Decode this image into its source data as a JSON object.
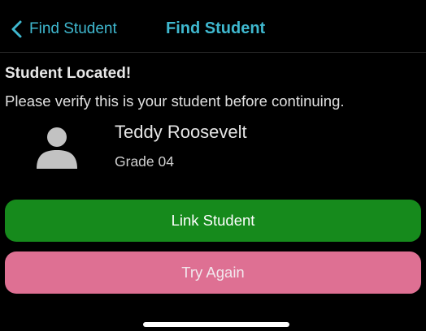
{
  "nav": {
    "back_label": "Find Student",
    "title": "Find Student",
    "accent_color": "#3fb8cf",
    "back_icon": "chevron-left-icon"
  },
  "content": {
    "heading": "Student Located!",
    "message": "Please verify this is your student before continuing."
  },
  "student": {
    "name": "Teddy Roosevelt",
    "grade": "Grade 04",
    "avatar_icon": "person-icon"
  },
  "actions": {
    "link_label": "Link Student",
    "link_color": "#168a1c",
    "retry_label": "Try Again",
    "retry_color": "#de7093"
  }
}
